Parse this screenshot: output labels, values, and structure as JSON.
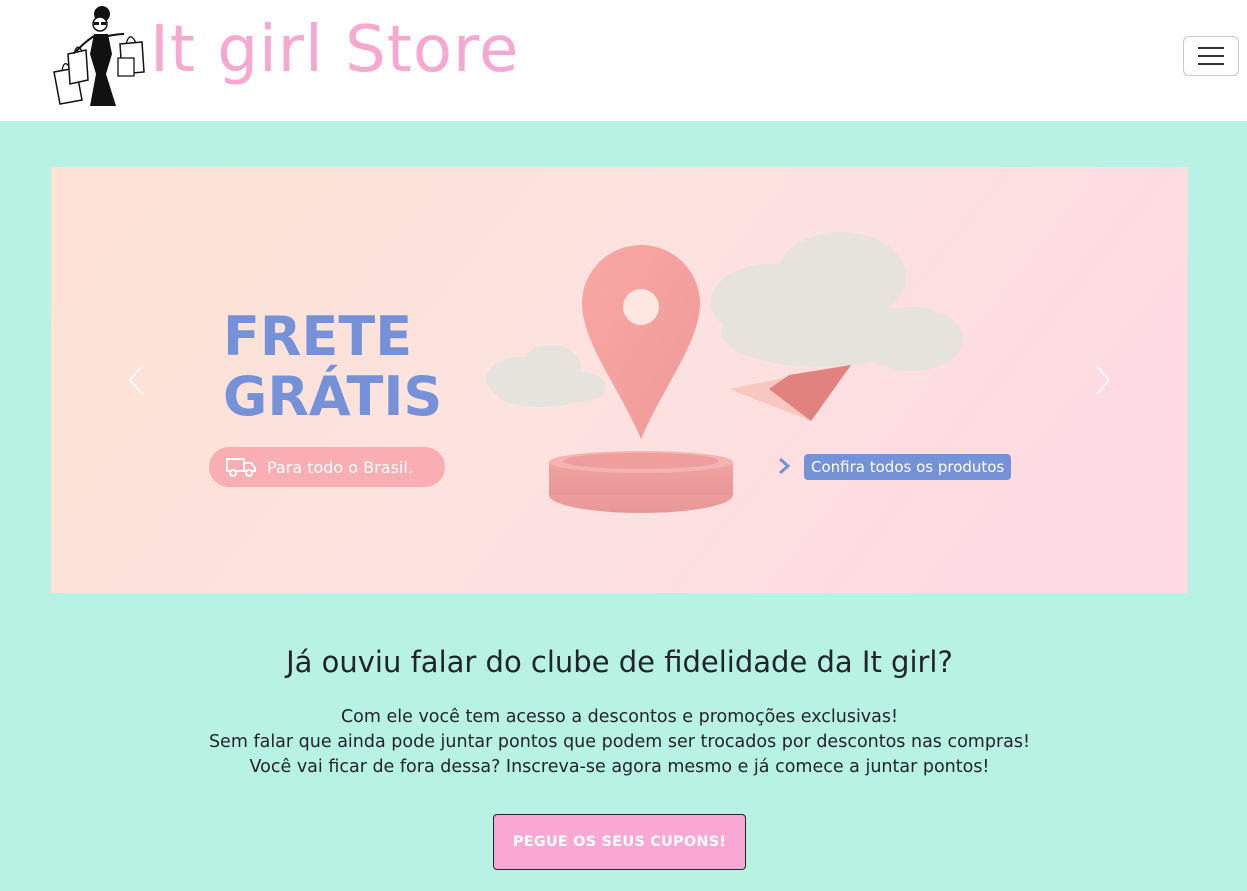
{
  "header": {
    "brand_name": "It girl Store",
    "logo_icon": "shopping-lady-icon",
    "menu_icon": "hamburger-menu-icon"
  },
  "carousel": {
    "slide": {
      "title_line1": "FRETE",
      "title_line2": "GRÁTIS",
      "pill_text": "Para todo o Brasil.",
      "pill_icon": "truck-icon",
      "link_text": "Confira todos os produtos"
    },
    "prev_icon": "chevron-left-icon",
    "next_icon": "chevron-right-icon"
  },
  "club": {
    "title": "Já ouviu falar do clube de fidelidade da It girl?",
    "lines": [
      "Com ele você tem acesso a descontos e promoções exclusivas!",
      "Sem falar que ainda pode juntar pontos que podem ser trocados por descontos nas compras!",
      "Você vai ficar de fora dessa? Inscreva-se agora mesmo e já comece a juntar pontos!"
    ],
    "cta_label": "PEGUE OS SEUS CUPONS!"
  },
  "colors": {
    "page_bg": "#b8f2e2",
    "brand_pink": "#f7a8d1",
    "banner_blue": "#7592d9",
    "pill_pink": "#f8aeb2",
    "cta_pink": "#f9a8d4"
  }
}
